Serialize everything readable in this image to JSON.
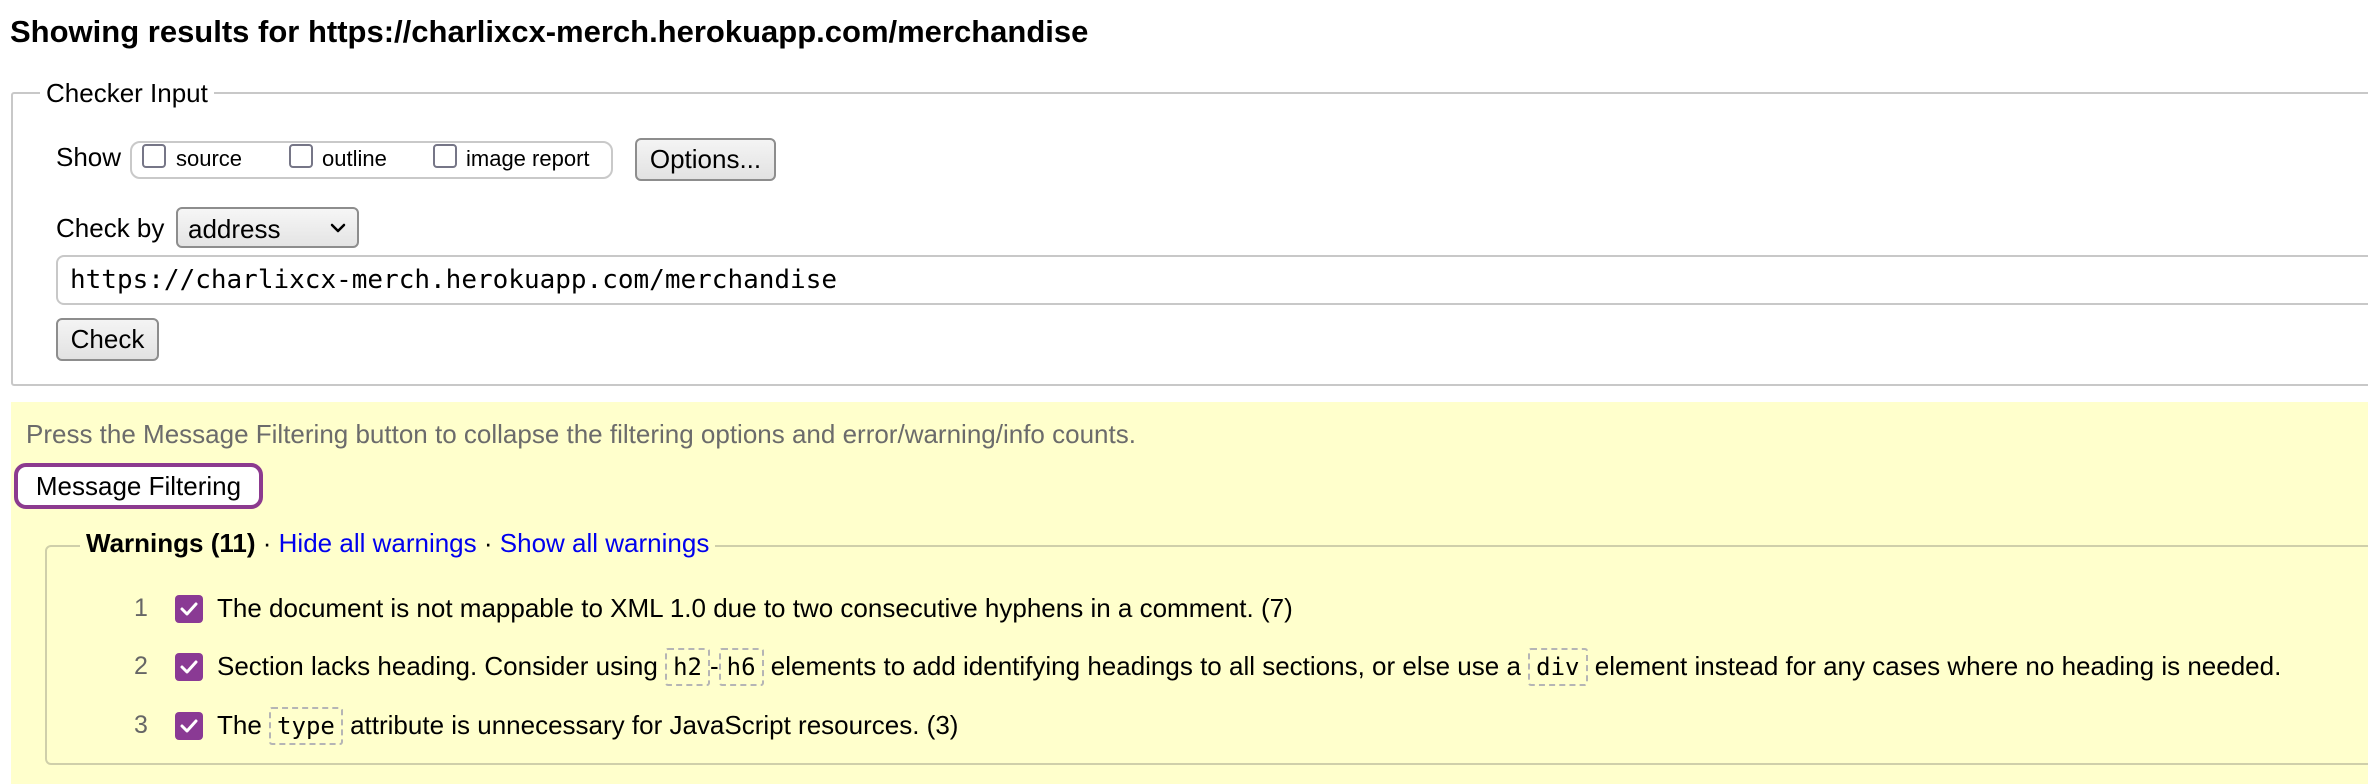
{
  "page": {
    "title": "Showing results for https://charlixcx-merch.herokuapp.com/merchandise"
  },
  "checker": {
    "legend": "Checker Input",
    "show_label": "Show",
    "show_options": [
      {
        "label": "source",
        "checked": false
      },
      {
        "label": "outline",
        "checked": false
      },
      {
        "label": "image report",
        "checked": false
      }
    ],
    "options_button": "Options...",
    "check_by_label": "Check by",
    "check_by_value": "address",
    "url_value": "https://charlixcx-merch.herokuapp.com/merchandise",
    "check_button": "Check"
  },
  "filtering": {
    "hint": "Press the Message Filtering button to collapse the filtering options and error/warning/info counts.",
    "button": "Message Filtering",
    "warnings_title": "Warnings (11)",
    "separator": "·",
    "hide_all": "Hide all warnings",
    "show_all": "Show all warnings",
    "items": [
      {
        "num": "1",
        "checked": true,
        "text": "The document is not mappable to XML 1.0 due to two consecutive hyphens in a comment. (7)"
      },
      {
        "num": "2",
        "checked": true,
        "text_a": "Section lacks heading. Consider using",
        "code_a": "h2",
        "dash": "-",
        "code_b": "h6",
        "text_b": "elements to add identifying headings to all sections, or else use a",
        "code_c": "div",
        "text_c": "element instead for any cases where no heading is needed."
      },
      {
        "num": "3",
        "checked": true,
        "text_a": "The",
        "code_a": "type",
        "text_b": "attribute is unnecessary for JavaScript resources. (3)"
      }
    ]
  },
  "colors": {
    "filter_background": "#ffffcc",
    "checkbox_accent": "#8a3a94",
    "link": "#0000ee"
  }
}
